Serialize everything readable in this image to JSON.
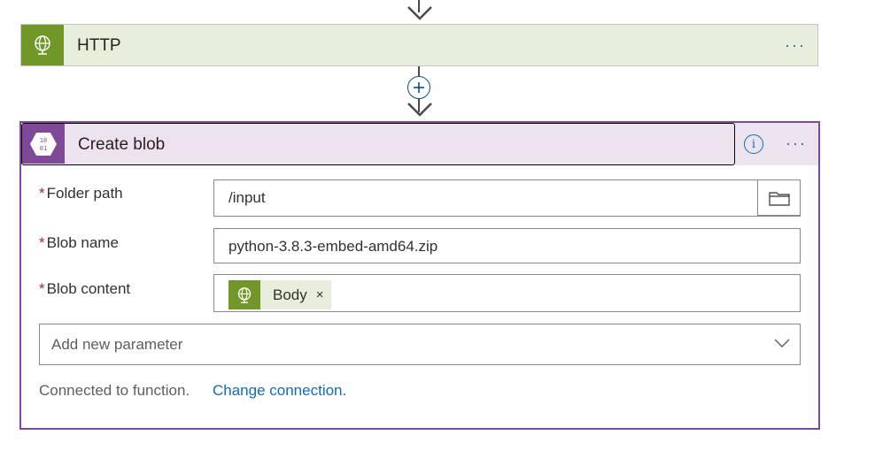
{
  "http_step": {
    "title": "HTTP",
    "icon": "globe-icon",
    "more_label": "···",
    "accent": "#709727"
  },
  "add_step": {
    "icon": "plus-icon"
  },
  "blob_step": {
    "title": "Create blob",
    "icon": "blob-binary-icon",
    "icon_text": "10 01",
    "info_label": "i",
    "more_label": "···",
    "accent": "#804998",
    "fields": {
      "folder_path": {
        "required_mark": "*",
        "label": "Folder path",
        "value": "/input"
      },
      "blob_name": {
        "required_mark": "*",
        "label": "Blob name",
        "value": "python-3.8.3-embed-amd64.zip"
      },
      "blob_content": {
        "required_mark": "*",
        "label": "Blob content",
        "token": {
          "label": "Body",
          "remove": "×",
          "icon": "globe-icon"
        }
      }
    },
    "add_parameter": {
      "placeholder": "Add new parameter"
    },
    "connection": {
      "text": "Connected to function.",
      "link": "Change connection."
    }
  }
}
